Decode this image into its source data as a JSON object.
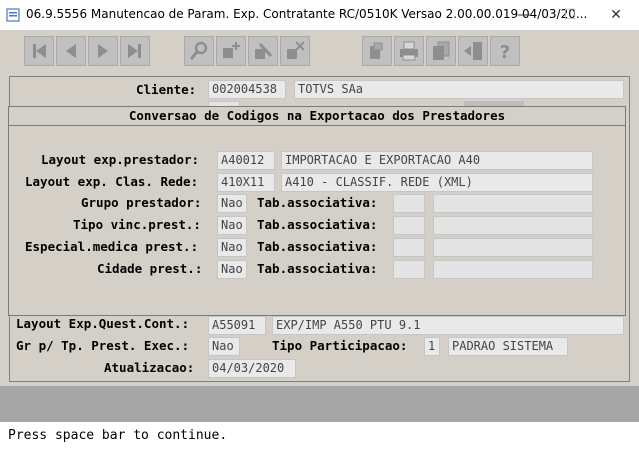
{
  "window": {
    "title": "06.9.5556 Manutencao  de Param. Exp. Contratante RC/0510K Versao 2.00.00.019 04/03/20...",
    "minimize_label": "—",
    "maximize_label": "☐",
    "close_label": "✕"
  },
  "toolbar": {
    "buttons": [
      {
        "icon": "first-record-icon"
      },
      {
        "icon": "previous-record-icon"
      },
      {
        "icon": "next-record-icon"
      },
      {
        "icon": "last-record-icon"
      },
      {
        "icon": "search-icon"
      },
      {
        "icon": "add-icon"
      },
      {
        "icon": "edit-icon"
      },
      {
        "icon": "delete-icon"
      },
      {
        "icon": "document-icon"
      },
      {
        "icon": "print-icon"
      },
      {
        "icon": "copy-icon"
      },
      {
        "icon": "exit-icon"
      },
      {
        "icon": "help-icon"
      }
    ]
  },
  "form": {
    "cliente_label": "Cliente:",
    "cliente_code": "002004538",
    "cliente_name": "TOTVS SAa",
    "layout_quest_label": "Layout Exp.Quest.Cont.:",
    "layout_quest_code": "A55091",
    "layout_quest_desc": "EXP/IMP A550 PTU 9.1",
    "gr_tp_label": "Gr p/ Tp. Prest. Exec.:",
    "gr_tp_value": "Nao",
    "tipo_part_label": "Tipo Participacao:",
    "tipo_part_code": "1",
    "tipo_part_desc": "PADRAO SISTEMA",
    "atualizacao_label": "Atualizacao:",
    "atualizacao_value": "04/03/2020"
  },
  "dialog": {
    "title": "Conversao de Codigos na Exportacao dos Prestadores",
    "layout_prest_label": "Layout exp.prestador:",
    "layout_prest_code": "A40012",
    "layout_prest_desc": "IMPORTACAO E EXPORTACAO A40",
    "layout_clas_label": "Layout exp. Clas. Rede:",
    "layout_clas_code": "410X11",
    "layout_clas_desc": "A410 - CLASSIF. REDE (XML)",
    "rows": [
      {
        "label": "Grupo prestador:",
        "value": "Nao",
        "tab_label": "Tab.associativa:"
      },
      {
        "label": "Tipo vinc.prest.:",
        "value": "Nao",
        "tab_label": "Tab.associativa:"
      },
      {
        "label": "Especial.medica prest.:",
        "value": "Nao",
        "tab_label": "Tab.associativa:"
      },
      {
        "label": "Cidade prest.:",
        "value": "Nao",
        "tab_label": "Tab.associativa:"
      }
    ]
  },
  "status_bar": {
    "message": "Press space bar to continue."
  }
}
